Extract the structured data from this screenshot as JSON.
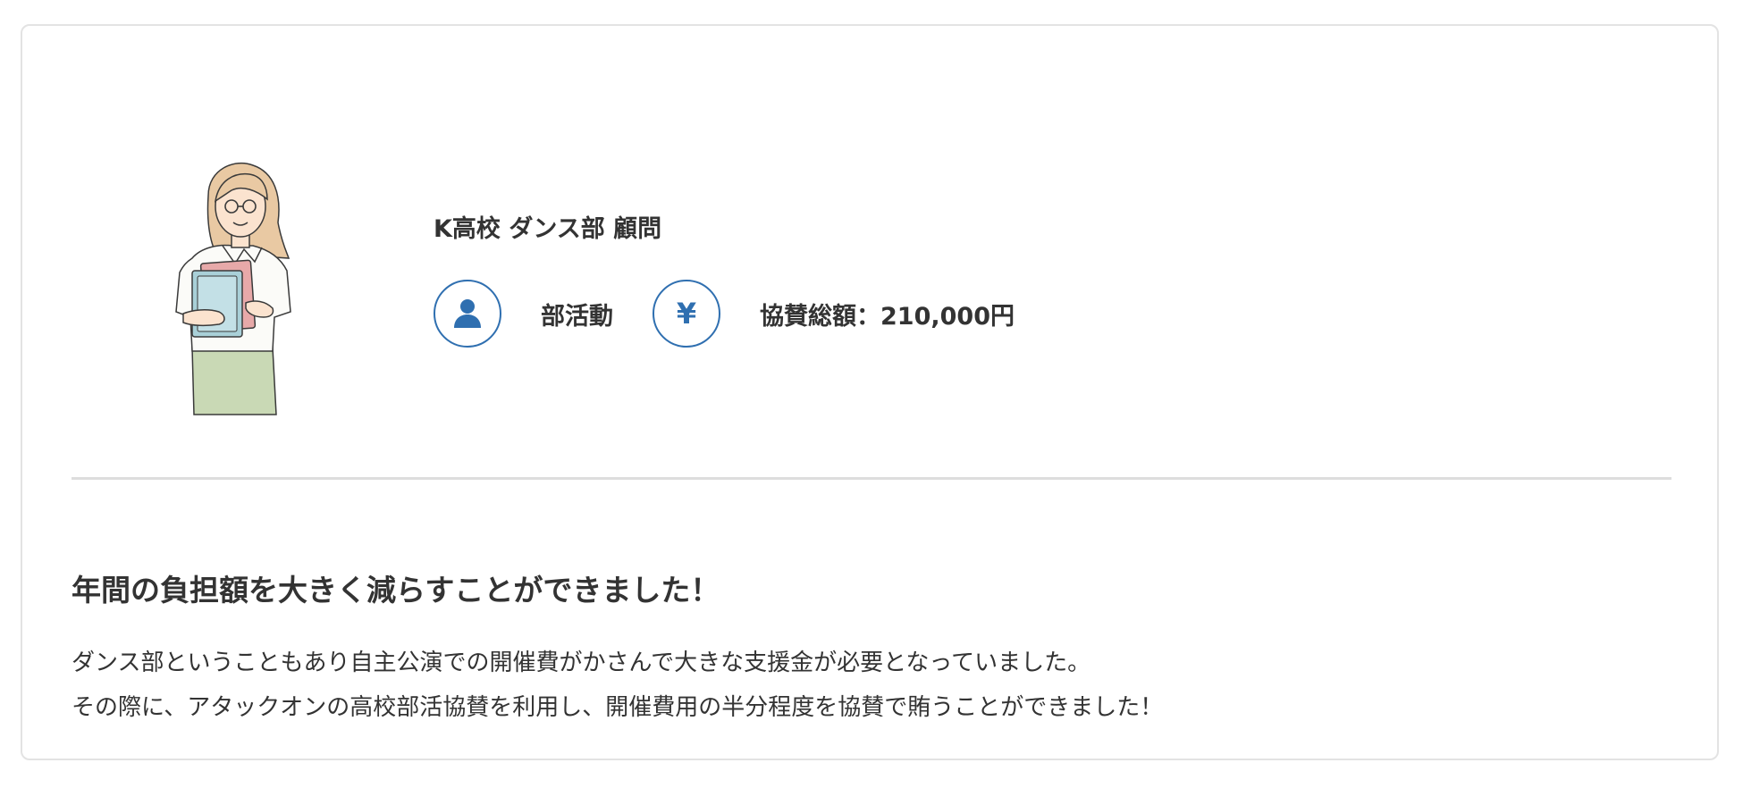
{
  "profile": {
    "title": "K高校 ダンス部 顧問",
    "category_label": "部活動",
    "amount_label": "協賛総額：210,000円",
    "category_icon": "person-icon",
    "amount_icon": "yen-icon",
    "yen_glyph": "¥"
  },
  "testimonial": {
    "headline": "年間の負担額を大きく減らすことができました！",
    "lines": [
      "ダンス部ということもあり自主公演での開催費がかさんで大きな支援金が必要となっていました。",
      "その際に、アタックオンの高校部活協賛を利用し、開催費用の半分程度を協賛で賄うことができました！"
    ]
  },
  "colors": {
    "accent": "#2f6fb0",
    "text": "#333333",
    "divider": "#dddddd",
    "border": "#e3e3e3"
  }
}
